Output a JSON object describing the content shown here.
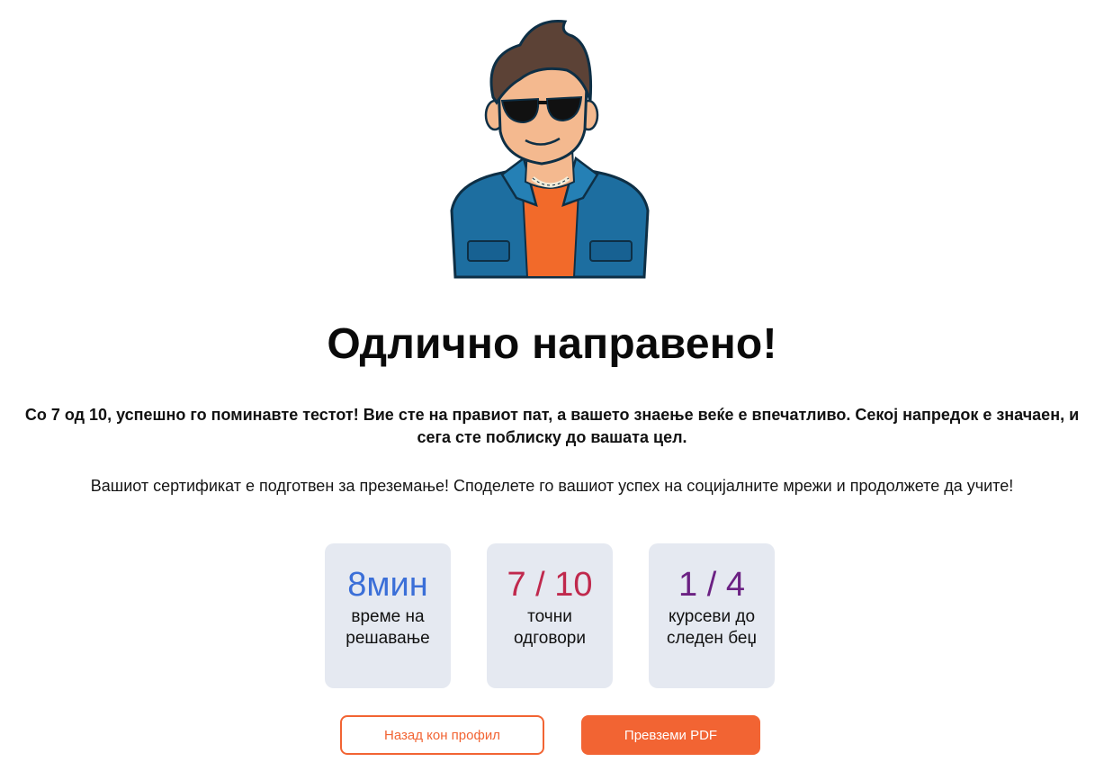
{
  "result": {
    "title": "Одлично направено!",
    "lead": "Со 7 од 10, успешно го поминавте тестот! Вие сте на правиот пат, а вашето знаење веќе е впечатливо. Секој напредок е значаен, и сега сте поблиску до вашата цел.",
    "sub": "Вашиот сертификат е подготвен за преземање! Споделете го вашиот успех на социјалните мрежи и продолжете да учите!"
  },
  "stats": [
    {
      "value": "8мин",
      "label": "време на решавање",
      "color": "#3b6fd8"
    },
    {
      "value": "7 / 10",
      "label": "точни одговори",
      "color": "#c0294d"
    },
    {
      "value": "1 / 4",
      "label": "курсеви до следен беџ",
      "color": "#6b2183"
    }
  ],
  "actions": {
    "back_label": "Назад кон профил",
    "download_label": "Превземи PDF"
  },
  "colors": {
    "accent": "#f26433",
    "card_bg": "#e5e9f1"
  },
  "illustration": {
    "icon": "cool-guy-sunglasses-mascot"
  }
}
